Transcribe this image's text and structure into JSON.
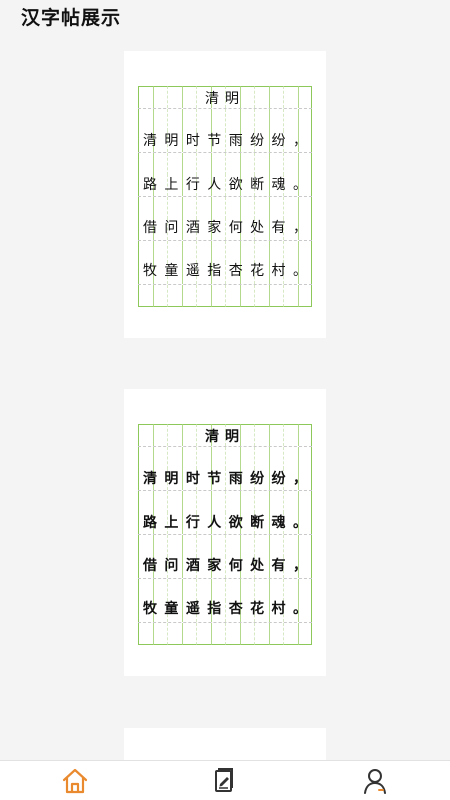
{
  "header": {
    "title": "汉字帖展示"
  },
  "cards": [
    {
      "style": "kaishu",
      "poem_title": "清明",
      "lines": [
        [
          "清",
          "明",
          "时",
          "节",
          "雨",
          "纷",
          "纷",
          "，"
        ],
        [
          "路",
          "上",
          "行",
          "人",
          "欲",
          "断",
          "魂",
          "。"
        ],
        [
          "借",
          "问",
          "酒",
          "家",
          "何",
          "处",
          "有",
          "，"
        ],
        [
          "牧",
          "童",
          "遥",
          "指",
          "杏",
          "花",
          "村",
          "。"
        ]
      ]
    },
    {
      "style": "calligraphy",
      "poem_title": "清明",
      "lines": [
        [
          "清",
          "明",
          "时",
          "节",
          "雨",
          "纷",
          "纷",
          "，"
        ],
        [
          "路",
          "上",
          "行",
          "人",
          "欲",
          "断",
          "魂",
          "。"
        ],
        [
          "借",
          "问",
          "酒",
          "家",
          "何",
          "处",
          "有",
          "，"
        ],
        [
          "牧",
          "童",
          "遥",
          "指",
          "杏",
          "花",
          "村",
          "。"
        ]
      ]
    }
  ],
  "tabbar": {
    "items": [
      {
        "icon": "home-icon",
        "active": true
      },
      {
        "icon": "notebook-icon",
        "active": false
      },
      {
        "icon": "user-icon",
        "active": false
      }
    ],
    "colors": {
      "active": "#e98a2e",
      "inactive": "#333333"
    }
  },
  "colors": {
    "grid": "#8cc85a",
    "grid_light": "#d6e9c4",
    "background": "#f4f4f4"
  }
}
